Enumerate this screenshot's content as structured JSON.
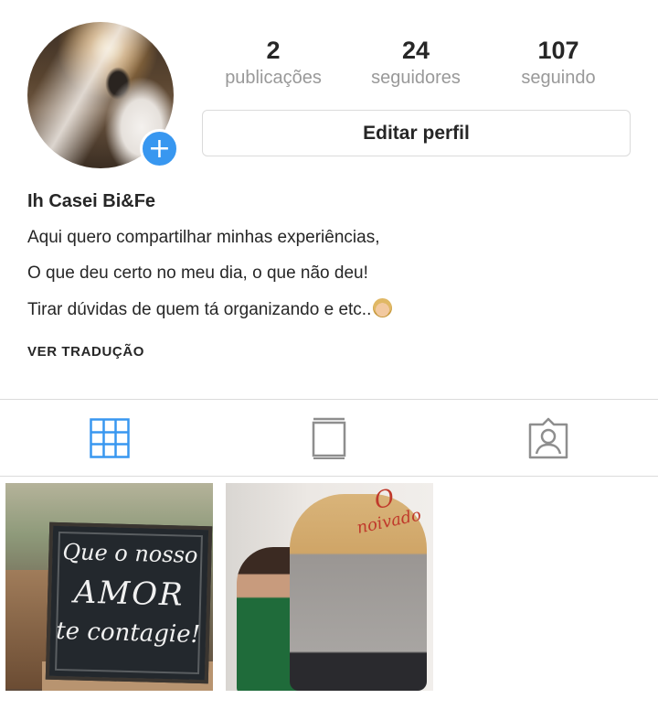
{
  "profile": {
    "display_name": "Ih Casei Bi&Fe",
    "add_symbol": "+"
  },
  "stats": [
    {
      "count": "2",
      "label": "publicações"
    },
    {
      "count": "24",
      "label": "seguidores"
    },
    {
      "count": "107",
      "label": "seguindo"
    }
  ],
  "edit_button": {
    "label": "Editar perfil"
  },
  "bio": {
    "lines": [
      "Aqui quero compartilhar minhas experiências,",
      "O que deu certo no meu dia, o que não deu!",
      "Tirar dúvidas de quem tá organizando e etc.."
    ],
    "trailing_emoji": "woman-emoji-icon"
  },
  "translate_link": "VER TRADUÇÃO",
  "tabs": [
    {
      "icon": "grid-icon",
      "active": true
    },
    {
      "icon": "guide-icon",
      "active": false
    },
    {
      "icon": "tagged-icon",
      "active": false
    }
  ],
  "colors": {
    "accent": "#3897f0",
    "text": "#262626",
    "muted": "#999999",
    "border": "#dbdbdb",
    "inactive_icon": "#8e8e8e",
    "grid_active": "#3897f0"
  },
  "posts": [
    {
      "board_text": [
        "Que o nosso",
        "AMOR",
        "te contagie!"
      ]
    },
    {
      "overlay_text": [
        "O",
        "noivado"
      ]
    }
  ]
}
